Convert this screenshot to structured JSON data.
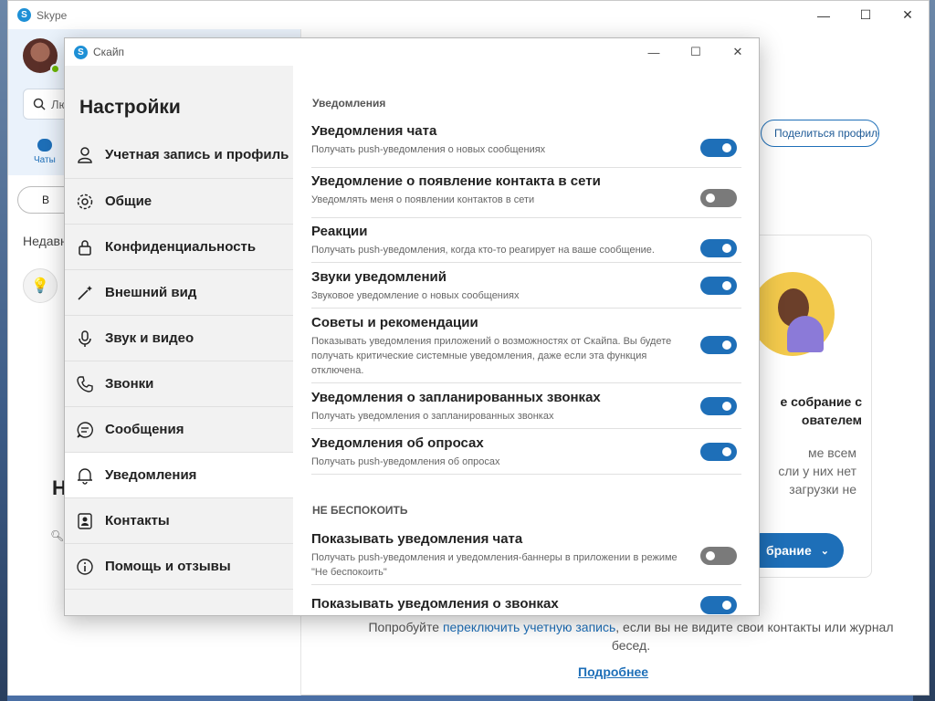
{
  "main_window": {
    "title": "Skype",
    "controls": [
      "—",
      "☐",
      "✕"
    ],
    "search_placeholder": "Лю",
    "chats_tab": "Чаты",
    "meet_button": "В",
    "recent_label": "Недавн",
    "big_heading": "Н",
    "share_profile_button": "Поделиться профилем",
    "card": {
      "title": "е собрание с\nователем",
      "text": "ме всем\nсли у них нет\nзагрузки не",
      "button": "брание"
    },
    "hint_before": "Попробуйте ",
    "hint_link": "переключить учетную запись",
    "hint_after": ", если вы не видите свои контакты или журнал бесед.",
    "more_link": "Подробнее"
  },
  "dialog": {
    "title": "Скайп",
    "controls": [
      "—",
      "☐",
      "✕"
    ]
  },
  "nav": {
    "title": "Настройки",
    "items": [
      {
        "label": "Учетная запись и профиль",
        "icon": "person-icon"
      },
      {
        "label": "Общие",
        "icon": "gear-icon"
      },
      {
        "label": "Конфиденциальность",
        "icon": "lock-icon"
      },
      {
        "label": "Внешний вид",
        "icon": "magic-wand-icon"
      },
      {
        "label": "Звук и видео",
        "icon": "microphone-icon"
      },
      {
        "label": "Звонки",
        "icon": "phone-icon"
      },
      {
        "label": "Сообщения",
        "icon": "message-icon"
      },
      {
        "label": "Уведомления",
        "icon": "bell-icon"
      },
      {
        "label": "Контакты",
        "icon": "contacts-icon"
      },
      {
        "label": "Помощь и отзывы",
        "icon": "info-icon"
      }
    ],
    "active_index": 7
  },
  "content": {
    "section1": "Уведомления",
    "rows": [
      {
        "title": "Уведомления чата",
        "desc": "Получать push-уведомления о новых сообщениях",
        "on": true
      },
      {
        "title": "Уведомление о появление контакта в сети",
        "desc": "Уведомлять меня о появлении контактов в сети",
        "on": false
      },
      {
        "title": "Реакции",
        "desc": "Получать push-уведомления, когда кто-то реагирует на ваше сообщение.",
        "on": true
      },
      {
        "title": "Звуки уведомлений",
        "desc": "Звуковое уведомление о новых сообщениях",
        "on": true
      },
      {
        "title": "Советы и рекомендации",
        "desc": "Показывать уведомления приложений о возможностях от Скайпа. Вы будете получать критические системные уведомления, даже если эта функция отключена.",
        "on": true
      },
      {
        "title": "Уведомления о запланированных звонках",
        "desc": "Получать уведомления о запланированных звонках",
        "on": true
      },
      {
        "title": "Уведомления об опросах",
        "desc": "Получать push-уведомления об опросах",
        "on": true
      }
    ],
    "section2": "НЕ БЕСПОКОИТЬ",
    "dnd_rows": [
      {
        "title": "Показывать уведомления чата",
        "desc": "Получать push-уведомления и уведомления-баннеры в приложении в режиме \"Не беспокоить\"",
        "on": false
      },
      {
        "title": "Показывать уведомления о звонках",
        "desc": "",
        "on": true
      }
    ]
  }
}
